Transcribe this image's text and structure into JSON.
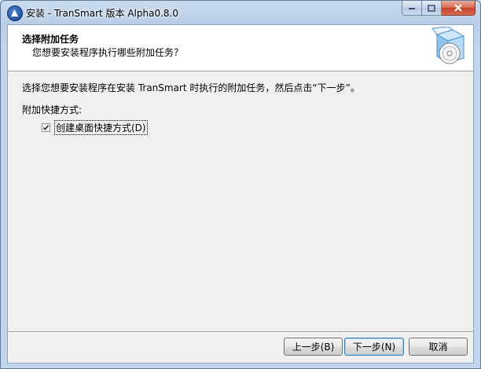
{
  "window": {
    "title": "安装 - TranSmart 版本 Alpha0.8.0"
  },
  "header": {
    "title": "选择附加任务",
    "subtitle": "您想要安装程序执行哪些附加任务？"
  },
  "content": {
    "description": "选择您想要安装程序在安装 TranSmart 时执行的附加任务，然后点击“下一步”。",
    "group_label": "附加快捷方式:",
    "checkbox": {
      "label": "创建桌面快捷方式(D)",
      "checked": true
    }
  },
  "buttons": {
    "back": "上一步(B)",
    "next": "下一步(N)",
    "cancel": "取消"
  },
  "icons": {
    "app": "transmart-logo-icon",
    "wizard": "setup-box-cd-icon"
  }
}
